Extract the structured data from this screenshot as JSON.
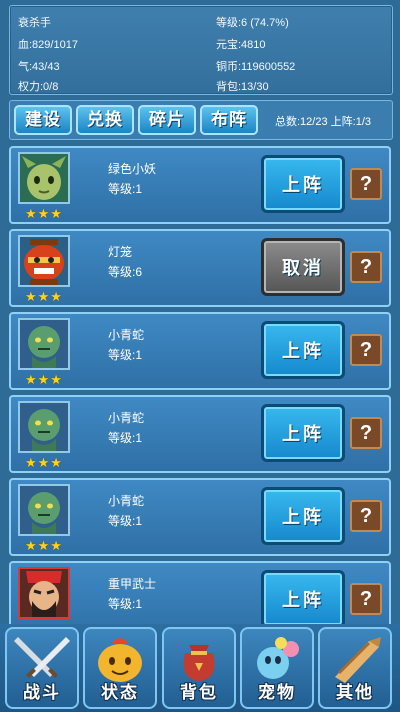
{
  "player": {
    "name": "衰杀手",
    "hp": "血:829/1017",
    "qi": "气:43/43",
    "power": "权力:0/8",
    "level": "等级:6 (74.7%)",
    "yuanbao": "元宝:4810",
    "copper": "铜币:119600552",
    "bag": "背包:13/30"
  },
  "tabs": [
    "建设",
    "兑换",
    "碎片",
    "布阵"
  ],
  "summary": "总数:12/23 上阵:1/3",
  "pets": [
    {
      "name": "绿色小妖",
      "level": "等级:1",
      "stars": "★★★",
      "action": "上阵",
      "active": false,
      "icon": "green-sprout-portrait",
      "help": "?"
    },
    {
      "name": "灯笼",
      "level": "等级:6",
      "stars": "★★★",
      "action": "取消",
      "active": true,
      "icon": "lantern-portrait",
      "help": "?"
    },
    {
      "name": "小青蛇",
      "level": "等级:1",
      "stars": "★★★",
      "action": "上阵",
      "active": false,
      "icon": "snake-portrait",
      "help": "?"
    },
    {
      "name": "小青蛇",
      "level": "等级:1",
      "stars": "★★★",
      "action": "上阵",
      "active": false,
      "icon": "snake-portrait",
      "help": "?"
    },
    {
      "name": "小青蛇",
      "level": "等级:1",
      "stars": "★★★",
      "action": "上阵",
      "active": false,
      "icon": "snake-portrait",
      "help": "?"
    },
    {
      "name": "重甲武士",
      "level": "等级:1",
      "stars": "",
      "action": "上阵",
      "active": false,
      "icon": "warrior-portrait",
      "help": "?"
    }
  ],
  "nav": [
    {
      "label": "战斗",
      "icon": "crossed-swords-icon"
    },
    {
      "label": "状态",
      "icon": "status-face-icon"
    },
    {
      "label": "背包",
      "icon": "bag-icon"
    },
    {
      "label": "宠物",
      "icon": "pet-icon"
    },
    {
      "label": "其他",
      "icon": "scroll-icon"
    }
  ]
}
